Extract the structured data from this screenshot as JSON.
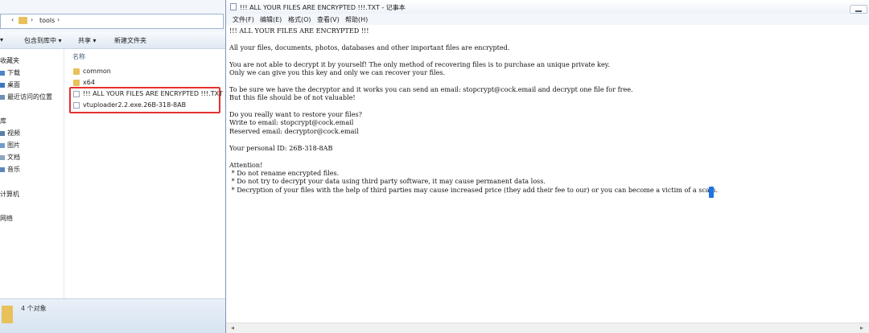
{
  "explorer": {
    "path": "tools",
    "toolbar": {
      "left_arrow": "▾",
      "include_library": "包含到库中 ▾",
      "share": "共享 ▾",
      "new_folder": "新建文件夹"
    },
    "nav": {
      "favorites": "收藏夹",
      "downloads": "下载",
      "desktop": "桌面",
      "recent": "最近访问的位置",
      "libraries": "库",
      "videos": "视频",
      "pictures": "图片",
      "documents": "文档",
      "music": "音乐",
      "computer": "计算机",
      "network": "网络"
    },
    "column_name": "名称",
    "files": [
      {
        "name": "common",
        "type": "folder"
      },
      {
        "name": "x64",
        "type": "folder"
      },
      {
        "name": "!!! ALL YOUR FILES ARE ENCRYPTED !!!.TXT",
        "type": "doc"
      },
      {
        "name": "vtuploader2.2.exe.26B-318-8AB",
        "type": "doc"
      }
    ],
    "status": "4 个对象"
  },
  "notepad": {
    "title": "!!! ALL YOUR FILES ARE ENCRYPTED !!!.TXT - 记事本",
    "menu": {
      "file": "文件(F)",
      "edit": "编辑(E)",
      "format": "格式(O)",
      "view": "查看(V)",
      "help": "帮助(H)"
    },
    "content": "!!! ALL YOUR FILES ARE ENCRYPTED !!!\n\nAll your files, documents, photos, databases and other important files are encrypted.\n\nYou are not able to decrypt it by yourself! The only method of recovering files is to purchase an unique private key.\nOnly we can give you this key and only we can recover your files.\n\nTo be sure we have the decryptor and it works you can send an email: stopcrypt@cock.email and decrypt one file for free.\nBut this file should be of not valuable!\n\nDo you really want to restore your files?\nWrite to email: stopcrypt@cock.email\nReserved email: decryptor@cock.email\n\nYour personal ID: 26B-318-8AB\n\nAttention!\n * Do not rename encrypted files.\n * Do not try to decrypt your data using third party software, it may cause permanent data loss.\n * Decryption of your files with the help of third parties may cause increased price (they add their fee to our) or you can become a victim of a scam."
  },
  "colors": {
    "highlight": "#e53030",
    "folder": "#e8c15a",
    "cursor": "#1a73e8"
  }
}
